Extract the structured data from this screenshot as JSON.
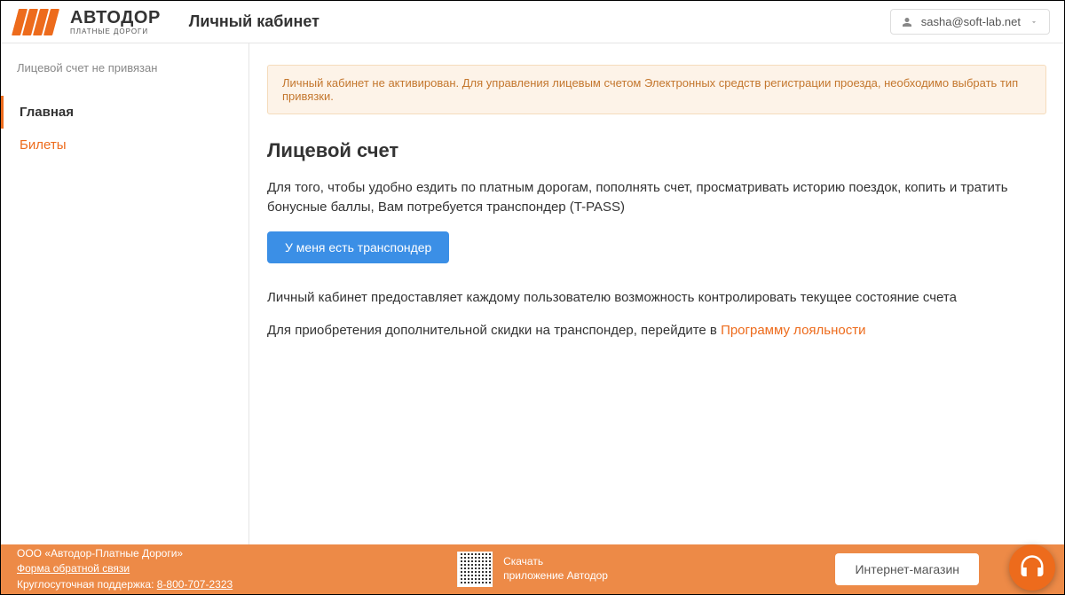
{
  "header": {
    "brand": "АВТОДОР",
    "brand_sub": "ПЛАТНЫЕ ДОРОГИ",
    "page_title": "Личный кабинет",
    "user_email": "sasha@soft-lab.net"
  },
  "sidebar": {
    "status": "Лицевой счет не привязан",
    "items": [
      {
        "label": "Главная",
        "active": true
      },
      {
        "label": "Билеты",
        "active": false
      }
    ]
  },
  "alert": {
    "text": "Личный кабинет не активирован. Для управления лицевым счетом Электронных средств регистрации проезда, необходимо выбрать тип привязки."
  },
  "main": {
    "title": "Лицевой счет",
    "intro": "Для того, чтобы удобно ездить по платным дорогам, пополнять счет, просматривать историю поездок, копить и тратить бонусные баллы, Вам потребуется транспондер (T-PASS)",
    "button_label": "У меня есть транспондер",
    "line2": "Личный кабинет предоставляет каждому пользователю возможность контролировать текущее состояние счета",
    "line3_prefix": "Для приобретения дополнительной скидки на транспондер, перейдите в ",
    "line3_link": "Программу лояльности"
  },
  "footer": {
    "company": "ООО «Автодор-Платные Дороги»",
    "feedback_link": "Форма обратной связи",
    "support_label": "Круглосуточная поддержка: ",
    "support_phone": "8-800-707-2323",
    "download_l1": "Скачать",
    "download_l2": "приложение Автодор",
    "shop_btn": "Интернет-магазин"
  }
}
